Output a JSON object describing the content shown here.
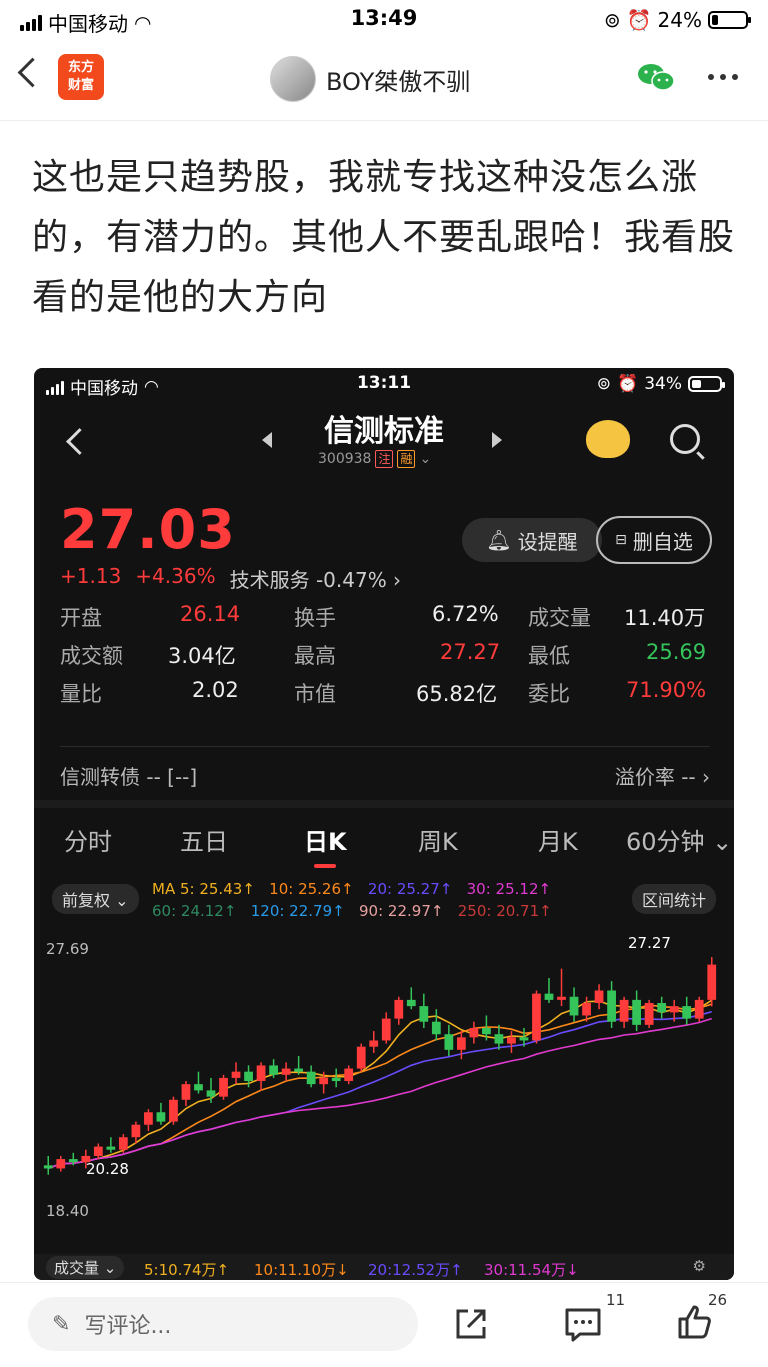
{
  "status_bar": {
    "carrier": "中国移动",
    "time": "13:49",
    "battery": "24%"
  },
  "nav": {
    "logo_text": "东方财富",
    "username": "BOY桀傲不驯"
  },
  "post": {
    "text": "这也是只趋势股，我就专找这种没怎么涨的，有潜力的。其他人不要乱跟哈！我看股看的是他的大方向"
  },
  "inner_status": {
    "carrier": "中国移动",
    "time": "13:11",
    "battery": "34%"
  },
  "stock": {
    "name": "信测标准",
    "code": "300938",
    "tag1": "注",
    "tag2": "融",
    "price": "27.03",
    "change": "+1.13",
    "change_pct": "+4.36%",
    "sector": "技术服务 -0.47%",
    "remind_label": "设提醒",
    "unwatch_label": "删自选"
  },
  "stats": [
    {
      "k": "开盘",
      "v": "26.14",
      "c": "red"
    },
    {
      "k": "换手",
      "v": "6.72%",
      "c": "wht"
    },
    {
      "k": "成交量",
      "v": "11.40万",
      "c": "wht"
    },
    {
      "k": "成交额",
      "v": "3.04亿",
      "c": "wht"
    },
    {
      "k": "最高",
      "v": "27.27",
      "c": "red"
    },
    {
      "k": "最低",
      "v": "25.69",
      "c": "green"
    },
    {
      "k": "量比",
      "v": "2.02",
      "c": "wht"
    },
    {
      "k": "市值",
      "v": "65.82亿",
      "c": "wht"
    },
    {
      "k": "委比",
      "v": "71.90%",
      "c": "red"
    }
  ],
  "bond": {
    "label": "信测转债 -- [--]",
    "premium": "溢价率 --"
  },
  "tabs": [
    "分时",
    "五日",
    "日K",
    "周K",
    "月K",
    "60分钟"
  ],
  "legend": {
    "adjust": "前复权",
    "range_stats": "区间统计",
    "ma_row1": [
      {
        "text": "MA 5: 25.43↑",
        "color": "#f0b020"
      },
      {
        "text": "10: 25.26↑",
        "color": "#ff8a1a"
      },
      {
        "text": "20: 25.27↑",
        "color": "#6a4cff"
      },
      {
        "text": "30: 25.12↑",
        "color": "#e03ad0"
      }
    ],
    "ma_row2": [
      {
        "text": "60: 24.12↑",
        "color": "#2f8a62"
      },
      {
        "text": "120: 22.79↑",
        "color": "#2a9be8"
      },
      {
        "text": "90: 22.97↑",
        "color": "#e8a0a0"
      },
      {
        "text": "250: 20.71↑",
        "color": "#c83a3a"
      }
    ]
  },
  "chart_data": {
    "type": "candlestick",
    "y_max_label": "27.69",
    "y_min_label": "18.40",
    "low_marker": "20.28",
    "high_marker": "27.27",
    "ylim": [
      18.4,
      27.69
    ],
    "ohlc": [
      [
        20.6,
        20.9,
        20.3,
        20.5
      ],
      [
        20.5,
        20.9,
        20.4,
        20.8
      ],
      [
        20.8,
        21.0,
        20.6,
        20.7
      ],
      [
        20.7,
        21.1,
        20.5,
        20.9
      ],
      [
        20.9,
        21.3,
        20.8,
        21.2
      ],
      [
        21.2,
        21.5,
        21.0,
        21.1
      ],
      [
        21.1,
        21.6,
        21.0,
        21.5
      ],
      [
        21.5,
        22.0,
        21.3,
        21.9
      ],
      [
        21.9,
        22.4,
        21.7,
        22.3
      ],
      [
        22.3,
        22.6,
        21.9,
        22.0
      ],
      [
        22.0,
        22.8,
        21.9,
        22.7
      ],
      [
        22.7,
        23.3,
        22.5,
        23.2
      ],
      [
        23.2,
        23.6,
        22.9,
        23.0
      ],
      [
        23.0,
        23.4,
        22.6,
        22.8
      ],
      [
        22.8,
        23.5,
        22.7,
        23.4
      ],
      [
        23.4,
        23.9,
        23.2,
        23.6
      ],
      [
        23.6,
        23.8,
        23.1,
        23.3
      ],
      [
        23.3,
        23.9,
        23.0,
        23.8
      ],
      [
        23.8,
        24.0,
        23.4,
        23.5
      ],
      [
        23.5,
        23.9,
        23.3,
        23.7
      ],
      [
        23.7,
        24.1,
        23.5,
        23.6
      ],
      [
        23.6,
        23.8,
        23.1,
        23.2
      ],
      [
        23.2,
        23.6,
        22.9,
        23.4
      ],
      [
        23.4,
        23.7,
        23.1,
        23.3
      ],
      [
        23.3,
        23.8,
        23.2,
        23.7
      ],
      [
        23.7,
        24.5,
        23.6,
        24.4
      ],
      [
        24.4,
        24.9,
        24.2,
        24.6
      ],
      [
        24.6,
        25.5,
        24.5,
        25.3
      ],
      [
        25.3,
        26.0,
        25.1,
        25.9
      ],
      [
        25.9,
        26.3,
        25.6,
        25.7
      ],
      [
        25.7,
        26.1,
        25.0,
        25.2
      ],
      [
        25.2,
        25.6,
        24.6,
        24.8
      ],
      [
        24.8,
        25.1,
        24.1,
        24.3
      ],
      [
        24.3,
        24.9,
        24.0,
        24.7
      ],
      [
        24.7,
        25.2,
        24.5,
        25.0
      ],
      [
        25.0,
        25.4,
        24.6,
        24.8
      ],
      [
        24.8,
        25.1,
        24.3,
        24.5
      ],
      [
        24.5,
        24.9,
        24.2,
        24.7
      ],
      [
        24.7,
        25.0,
        24.4,
        24.6
      ],
      [
        24.6,
        26.2,
        24.5,
        26.1
      ],
      [
        26.1,
        26.6,
        25.8,
        25.9
      ],
      [
        25.9,
        26.9,
        25.7,
        26.0
      ],
      [
        26.0,
        26.3,
        25.2,
        25.4
      ],
      [
        25.4,
        26.0,
        25.2,
        25.8
      ],
      [
        25.8,
        26.4,
        25.6,
        26.2
      ],
      [
        26.2,
        26.5,
        25.0,
        25.2
      ],
      [
        25.2,
        26.0,
        25.0,
        25.9
      ],
      [
        25.9,
        26.2,
        24.9,
        25.1
      ],
      [
        25.1,
        25.9,
        25.0,
        25.8
      ],
      [
        25.8,
        26.0,
        25.3,
        25.5
      ],
      [
        25.5,
        25.9,
        25.2,
        25.7
      ],
      [
        25.7,
        26.0,
        25.1,
        25.3
      ],
      [
        25.3,
        26.0,
        25.2,
        25.9
      ],
      [
        25.9,
        27.27,
        25.69,
        27.03
      ]
    ]
  },
  "volume_bar": {
    "label": "成交量",
    "items": [
      {
        "text": "5:10.74万↑",
        "color": "#f0b020"
      },
      {
        "text": "10:11.10万↓",
        "color": "#ff8a1a"
      },
      {
        "text": "20:12.52万↑",
        "color": "#6a4cff"
      },
      {
        "text": "30:11.54万↓",
        "color": "#e03ad0"
      }
    ]
  },
  "bottom_bar": {
    "comment_placeholder": "写评论...",
    "comment_count": "11",
    "like_count": "26"
  }
}
